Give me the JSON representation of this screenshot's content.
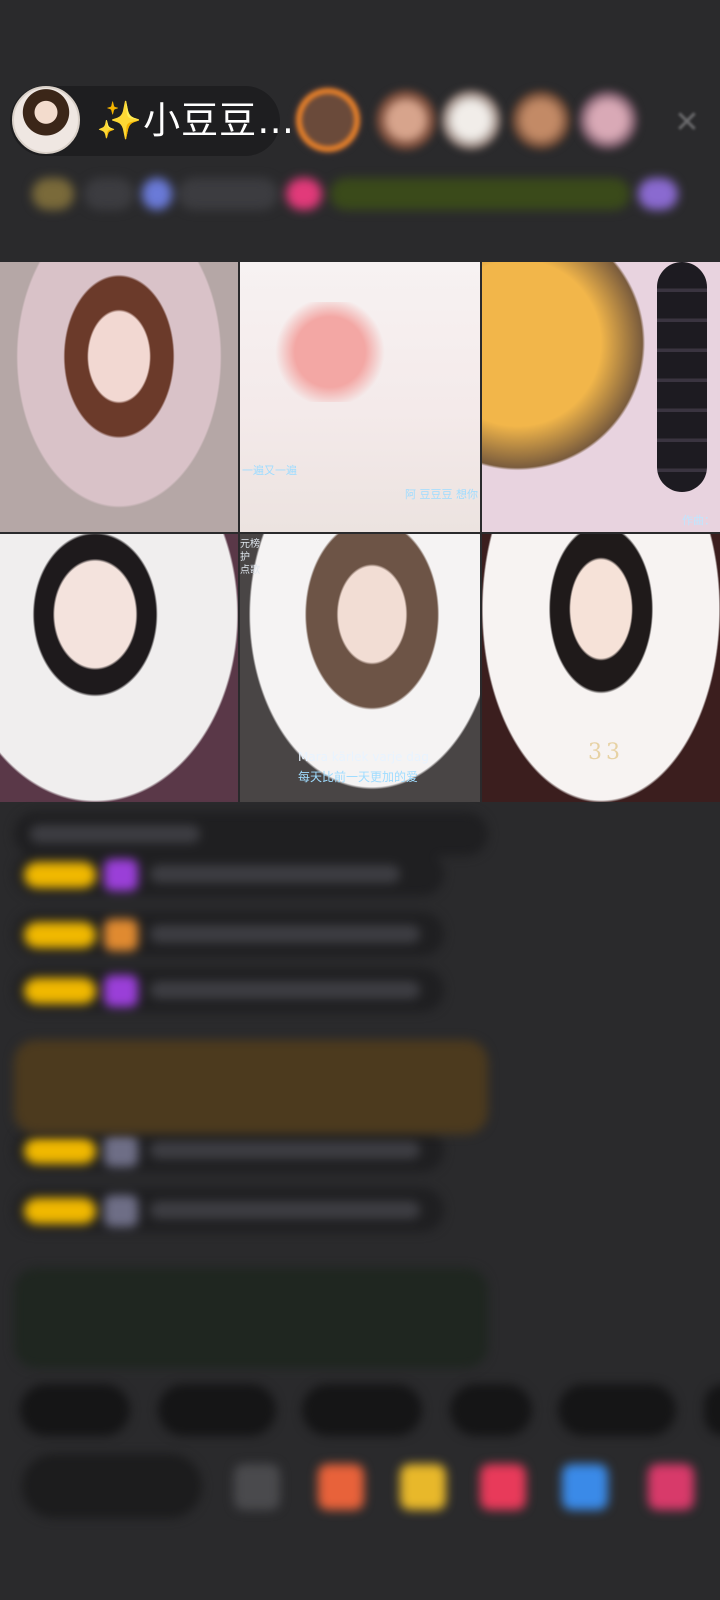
{
  "header": {
    "host_name": "✨小豆豆…",
    "close_icon": "close-icon"
  },
  "video_grid": {
    "tiles": [
      {
        "label": ""
      },
      {
        "overlay_left": "一遍又一遍",
        "overlay_right": "阿 豆豆豆 想你 一直"
      },
      {
        "overlay_corner": "作曲："
      },
      {
        "label": ""
      },
      {
        "side_sign": [
          "元榜",
          "护",
          "点歌"
        ],
        "caption_1": "Mara kärlek varje dag",
        "caption_2": "每天比前一天更加的爱"
      },
      {
        "number_badge": "33"
      }
    ]
  },
  "colors": {
    "background": "#2a2a2c",
    "badge_yellow": "#f0b800",
    "gem_purple": "#9a3fd8",
    "caption_blue": "#9fdcff"
  }
}
